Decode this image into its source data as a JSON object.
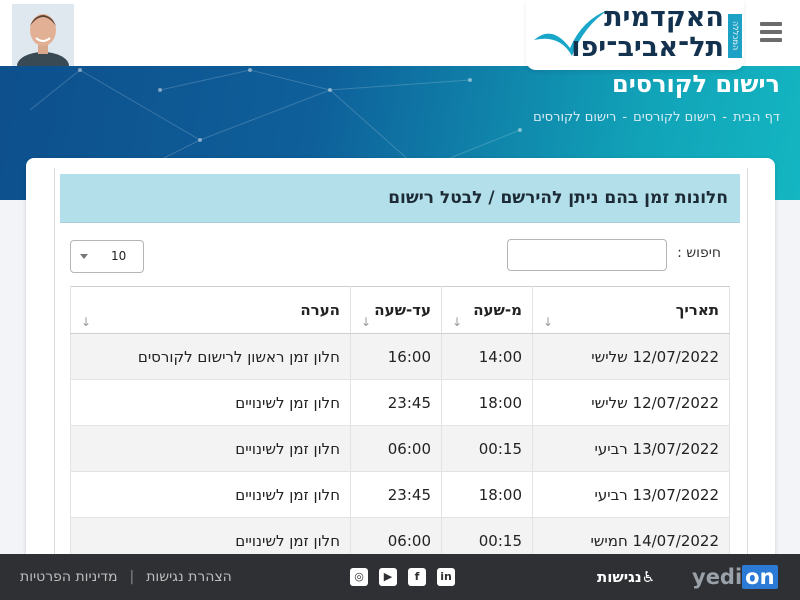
{
  "header": {
    "logo_line1": "האקדמית",
    "logo_line2": "תל־אביב־יפו",
    "logo_vertical": "המכללה",
    "page_title": "רישום לקורסים",
    "breadcrumb": [
      "דף הבית",
      "רישום לקורסים",
      "רישום לקורסים"
    ],
    "breadcrumb_sep": "-"
  },
  "panel": {
    "title": "חלונות זמן בהם ניתן להירשם / לבטל רישום",
    "search_label": "חיפוש :",
    "search_value": "",
    "page_length": "10"
  },
  "table": {
    "columns": [
      "תאריך",
      "מ-שעה",
      "עד-שעה",
      "הערה"
    ],
    "rows": [
      [
        "12/07/2022 שלישי",
        "14:00",
        "16:00",
        "חלון זמן ראשון לרישום לקורסים"
      ],
      [
        "12/07/2022 שלישי",
        "18:00",
        "23:45",
        "חלון זמן לשינויים"
      ],
      [
        "13/07/2022 רביעי",
        "00:15",
        "06:00",
        "חלון זמן לשינויים"
      ],
      [
        "13/07/2022 רביעי",
        "18:00",
        "23:45",
        "חלון זמן לשינויים"
      ],
      [
        "14/07/2022 חמישי",
        "00:15",
        "06:00",
        "חלון זמן לשינויים"
      ]
    ]
  },
  "footer": {
    "link_accessibility_statement": "הצהרת נגישות",
    "link_privacy": "מדיניות הפרטיות",
    "divider": "|",
    "accessibility_label": "נגישות",
    "brand_prefix": "yedi",
    "brand_suffix": "on",
    "social": [
      "instagram-icon",
      "youtube-icon",
      "facebook-icon",
      "linkedin-icon"
    ]
  },
  "colors": {
    "panel_header": "#b3dfea",
    "footer_bg": "#2f3033",
    "hero_dark": "#0d4f8c",
    "hero_light": "#14b6c2",
    "brand_blue": "#2a7ad6"
  }
}
